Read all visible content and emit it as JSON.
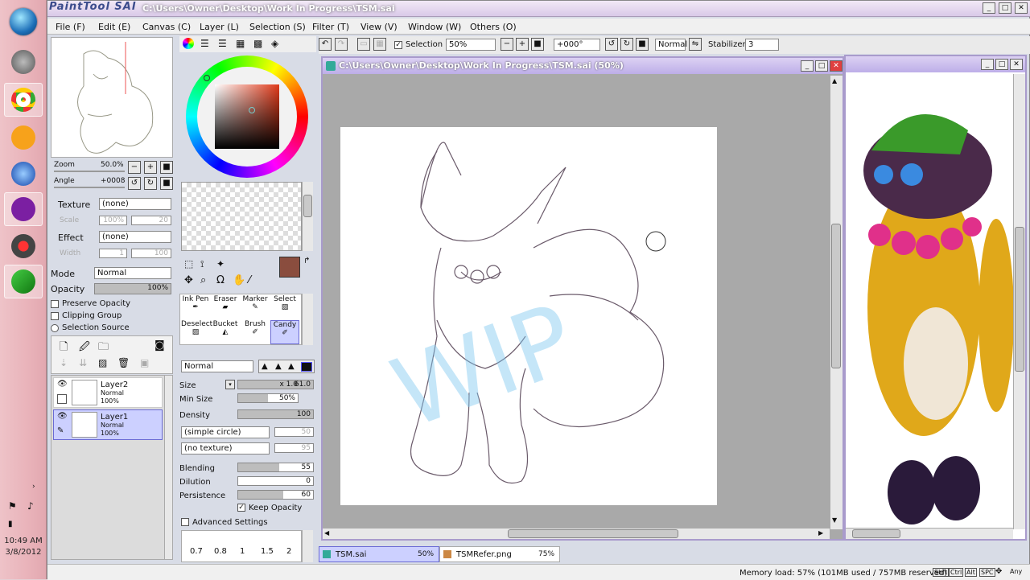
{
  "window": {
    "logo": "PaintTool SAI",
    "title": "C:\\Users\\Owner\\Desktop\\Work In Progress\\TSM.sai"
  },
  "menu": [
    "File (F)",
    "Edit (E)",
    "Canvas (C)",
    "Layer (L)",
    "Selection (S)",
    "Filter (T)",
    "View (V)",
    "Window (W)",
    "Others (O)"
  ],
  "toolbar": {
    "selection_label": "Selection",
    "zoom": "50%",
    "angle": "+000°",
    "mode": "Normal",
    "stabilizer_label": "Stabilizer",
    "stabilizer": "3"
  },
  "navigator": {
    "zoom_label": "Zoom",
    "zoom_value": "50.0%",
    "angle_label": "Angle",
    "angle_value": "+0008"
  },
  "texture": {
    "label": "Texture",
    "value": "(none)",
    "scale_label": "Scale",
    "scale_value": "100%",
    "scale_num": "20"
  },
  "effect": {
    "label": "Effect",
    "value": "(none)",
    "width_label": "Width",
    "width_value": "1",
    "width_num": "100"
  },
  "layer_props": {
    "mode_label": "Mode",
    "mode_value": "Normal",
    "opacity_label": "Opacity",
    "opacity_value": "100%",
    "preserve": "Preserve Opacity",
    "clipping": "Clipping Group",
    "selection_source": "Selection Source"
  },
  "layers": [
    {
      "name": "Layer2",
      "mode": "Normal",
      "opacity": "100%"
    },
    {
      "name": "Layer1",
      "mode": "Normal",
      "opacity": "100%"
    }
  ],
  "tools": [
    {
      "label": "Ink Pen"
    },
    {
      "label": "Eraser"
    },
    {
      "label": "Marker"
    },
    {
      "label": "Select"
    },
    {
      "label": "Deselect"
    },
    {
      "label": "Bucket"
    },
    {
      "label": "Brush"
    },
    {
      "label": "Candy"
    }
  ],
  "brush": {
    "blend_mode": "Normal",
    "size_label": "Size",
    "size_mult": "x 1.0",
    "size_value": "61.0",
    "min_size_label": "Min Size",
    "min_size_value": "50%",
    "density_label": "Density",
    "density_value": "100",
    "shape": "(simple circle)",
    "shape_num": "50",
    "texture": "(no texture)",
    "texture_num": "95",
    "blending_label": "Blending",
    "blending_value": "55",
    "dilution_label": "Dilution",
    "dilution_value": "0",
    "persistence_label": "Persistence",
    "persistence_value": "60",
    "keep_opacity": "Keep Opacity",
    "advanced": "Advanced Settings",
    "sizes": [
      "0.7",
      "0.8",
      "1",
      "1.5",
      "2"
    ]
  },
  "canvas": {
    "title": "C:\\Users\\Owner\\Desktop\\Work In Progress\\TSM.sai (50%)",
    "watermark": "WIP"
  },
  "tabs": [
    {
      "name": "TSM.sai",
      "zoom": "50%"
    },
    {
      "name": "TSMRefer.png",
      "zoom": "75%"
    }
  ],
  "status": {
    "memory": "Memory load: 57% (101MB used / 757MB reserved)",
    "keys": [
      "Shft",
      "Ctrl",
      "Alt",
      "SPC",
      "",
      "Any"
    ]
  },
  "clock": {
    "time": "10:49 AM",
    "date": "3/8/2012"
  },
  "colors": {
    "accent": "#8a4d3e",
    "selected": "#ccd0ff"
  }
}
